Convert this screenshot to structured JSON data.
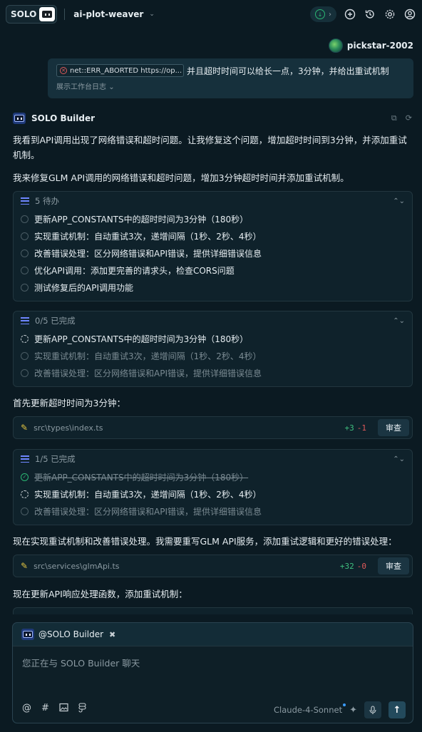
{
  "topbar": {
    "logo_text": "SOLO",
    "project_name": "ai-plot-weaver",
    "icons": [
      "download-status-icon",
      "new-chat-icon",
      "history-icon",
      "settings-icon",
      "account-icon"
    ]
  },
  "user_message": {
    "username": "pickstar-2002",
    "error_chip": "net::ERR_ABORTED https://op...",
    "text": "并且超时时间可以给长一点，3分钟，并给出重试机制",
    "log_link": "展示工作台日志"
  },
  "builder": {
    "name": "SOLO Builder"
  },
  "messages": {
    "p1": "我看到API调用出现了网络错误和超时问题。让我修复这个问题，增加超时时间到3分钟，并添加重试机制。",
    "p2": "我来修复GLM API调用的网络错误和超时问题，增加3分钟超时时间并添加重试机制。",
    "p3": "首先更新超时时间为3分钟：",
    "p4": "现在实现重试机制和改善错误处理。我需要重写GLM API服务，添加重试逻辑和更好的错误处理：",
    "p5": "现在更新API响应处理函数，添加重试机制："
  },
  "todo_card_1": {
    "title": "5 待办",
    "items": [
      "更新APP_CONSTANTS中的超时时间为3分钟（180秒）",
      "实现重试机制：自动重试3次，递增间隔（1秒、2秒、4秒）",
      "改善错误处理：区分网络错误和API错误，提供详细错误信息",
      "优化API调用：添加更完善的请求头，检查CORS问题",
      "测试修复后的API调用功能"
    ]
  },
  "todo_card_2": {
    "title": "0/5 已完成",
    "items": [
      "更新APP_CONSTANTS中的超时时间为3分钟（180秒）",
      "实现重试机制：自动重试3次，递增间隔（1秒、2秒、4秒）",
      "改善错误处理：区分网络错误和API错误，提供详细错误信息"
    ]
  },
  "todo_card_3": {
    "title": "1/5 已完成",
    "items": [
      "更新APP_CONSTANTS中的超时时间为3分钟（180秒）",
      "实现重试机制：自动重试3次，递增间隔（1秒、2秒、4秒）",
      "改善错误处理：区分网络错误和API错误，提供详细错误信息"
    ]
  },
  "file_1": {
    "path": "src\\types\\index.ts",
    "added": "+3",
    "removed": "-1",
    "review_label": "审查"
  },
  "file_2": {
    "path": "src\\services\\glmApi.ts",
    "added": "+32",
    "removed": "-0",
    "review_label": "审查"
  },
  "input": {
    "mention": "@SOLO Builder",
    "placeholder": "您正在与 SOLO Builder 聊天",
    "model": "Claude-4-Sonnet"
  },
  "colors": {
    "background": "#0b1a22",
    "accent_green": "#2bb673",
    "accent_red": "#e05a5a",
    "accent_blue": "#6e86ff"
  }
}
